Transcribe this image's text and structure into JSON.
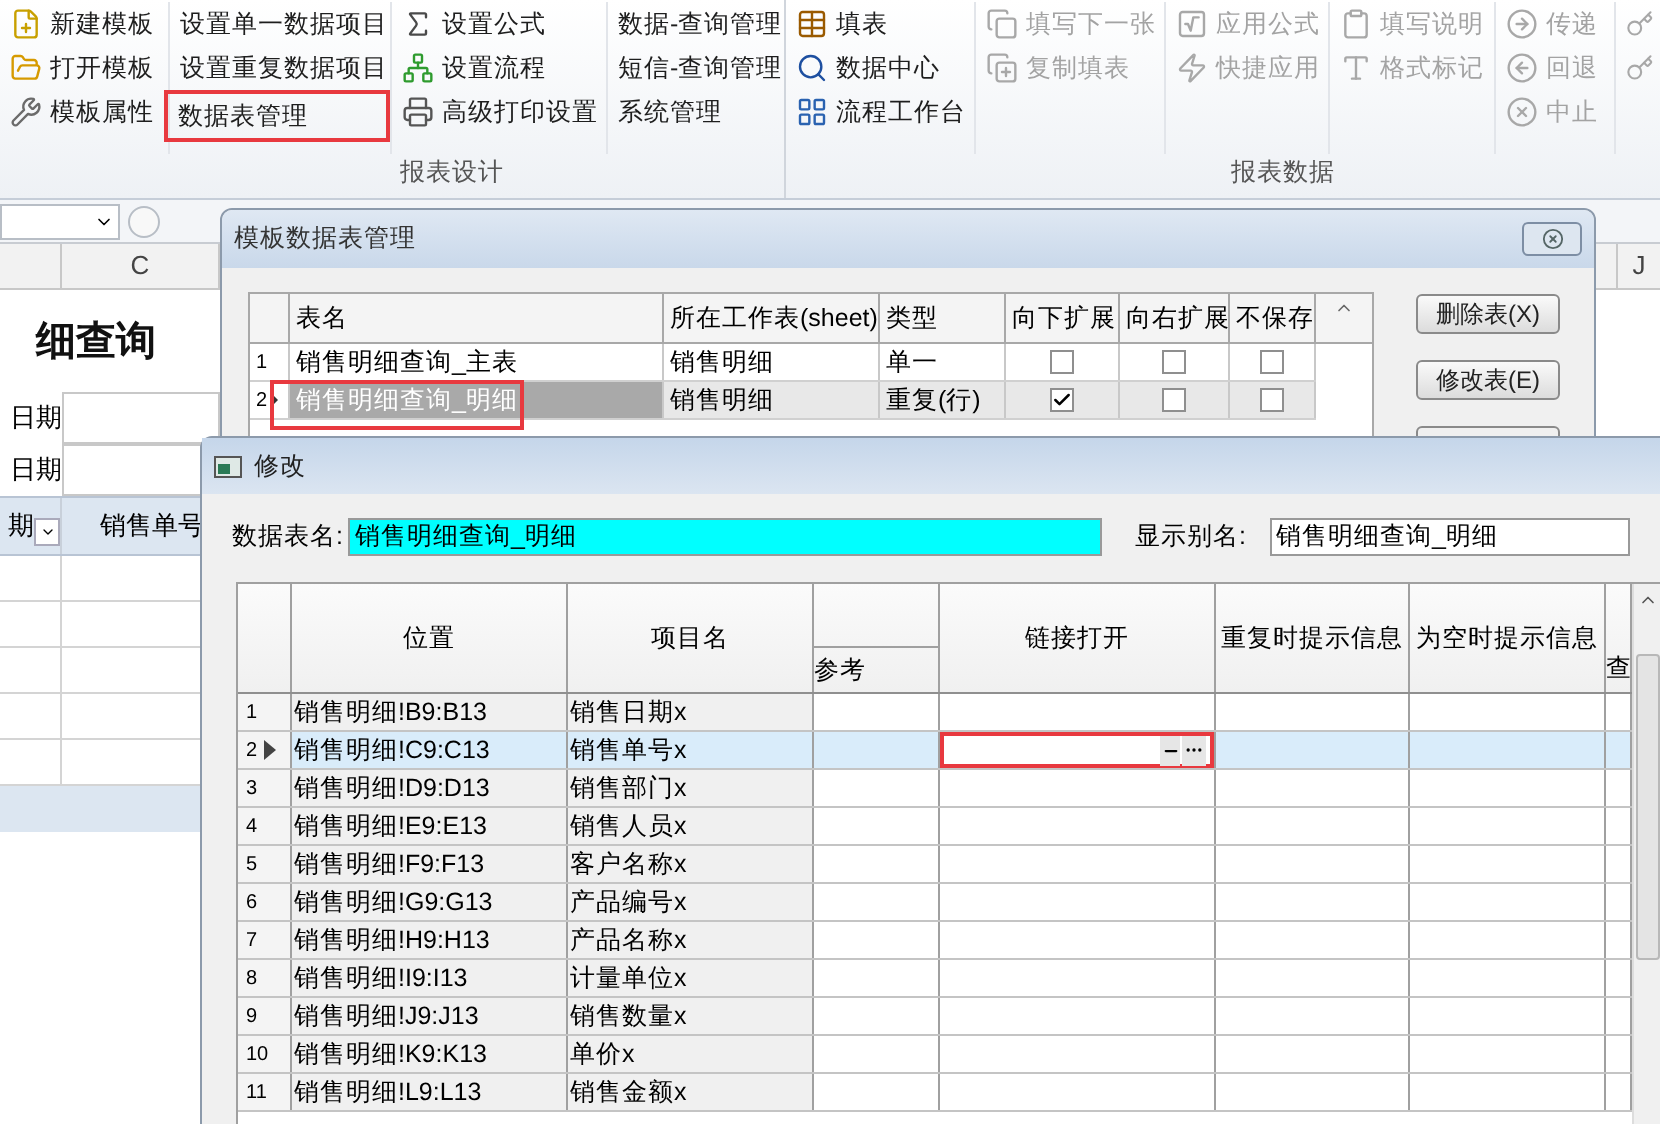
{
  "ribbon": {
    "groups": [
      {
        "label": "报表设计",
        "columns": [
          [
            {
              "label": "新建模板",
              "disabled": false,
              "highlighted": false
            },
            {
              "label": "打开模板",
              "disabled": false,
              "highlighted": false
            },
            {
              "label": "模板属性",
              "disabled": false,
              "highlighted": false
            }
          ],
          [
            {
              "label": "设置单一数据项目",
              "disabled": false,
              "highlighted": false
            },
            {
              "label": "设置重复数据项目",
              "disabled": false,
              "highlighted": false
            },
            {
              "label": "数据表管理",
              "disabled": false,
              "highlighted": true
            }
          ],
          [
            {
              "label": "设置公式",
              "disabled": false,
              "highlighted": false
            },
            {
              "label": "设置流程",
              "disabled": false,
              "highlighted": false
            },
            {
              "label": "高级打印设置",
              "disabled": false,
              "highlighted": false
            }
          ],
          [
            {
              "label": "数据-查询管理",
              "disabled": false,
              "highlighted": false
            },
            {
              "label": "短信-查询管理",
              "disabled": false,
              "highlighted": false
            },
            {
              "label": "系统管理",
              "disabled": false,
              "highlighted": false
            }
          ]
        ]
      },
      {
        "label": "报表数据",
        "columns": [
          [
            {
              "label": "填表",
              "disabled": false,
              "highlighted": false
            },
            {
              "label": "数据中心",
              "disabled": false,
              "highlighted": false
            },
            {
              "label": "流程工作台",
              "disabled": false,
              "highlighted": false
            }
          ],
          [
            {
              "label": "填写下一张",
              "disabled": true,
              "highlighted": false
            },
            {
              "label": "复制填表",
              "disabled": true,
              "highlighted": false
            }
          ],
          [
            {
              "label": "应用公式",
              "disabled": true,
              "highlighted": false
            },
            {
              "label": "快捷应用",
              "disabled": true,
              "highlighted": false
            }
          ],
          [
            {
              "label": "填写说明",
              "disabled": true,
              "highlighted": false
            },
            {
              "label": "格式标记",
              "disabled": true,
              "highlighted": false
            }
          ],
          [
            {
              "label": "传递",
              "disabled": true,
              "highlighted": false
            },
            {
              "label": "回退",
              "disabled": true,
              "highlighted": false
            },
            {
              "label": "中止",
              "disabled": true,
              "highlighted": false
            }
          ],
          [
            {
              "disabled": true,
              "highlighted": false
            },
            {
              "disabled": true,
              "highlighted": false
            }
          ]
        ]
      }
    ]
  },
  "sheet": {
    "column_headers": [
      "C",
      "J"
    ],
    "title": "细查询",
    "labels": [
      "日期",
      "日期"
    ],
    "header_cells": [
      "期",
      "销售单号"
    ]
  },
  "table_dialog": {
    "title": "模板数据表管理",
    "columns": [
      "表名",
      "所在工作表(sheet)",
      "类型",
      "向下扩展",
      "向右扩展",
      "不保存"
    ],
    "rows": [
      {
        "num": "1",
        "name": "销售明细查询_主表",
        "sheet": "销售明细",
        "type": "单一",
        "expand_down": false,
        "expand_right": false,
        "no_save": false,
        "selected": false,
        "highlighted": false
      },
      {
        "num": "2",
        "name": "销售明细查询_明细",
        "sheet": "销售明细",
        "type": "重复(行)",
        "expand_down": true,
        "expand_right": false,
        "no_save": false,
        "selected": true,
        "highlighted": true
      }
    ],
    "buttons": [
      "删除表(X)",
      "修改表(E)"
    ]
  },
  "edit_dialog": {
    "title": "修改",
    "table_name_label": "数据表名:",
    "table_name": "销售明细查询_明细",
    "alias_label": "显示别名:",
    "alias": "销售明细查询_明细",
    "columns": [
      {
        "label": "位置"
      },
      {
        "label": "项目名"
      },
      {
        "sublabel": "参考"
      },
      {
        "label": "链接打开"
      },
      {
        "label": "重复时提示信息"
      },
      {
        "label": "为空时提示信息"
      },
      {
        "label": "查"
      }
    ],
    "rows": [
      {
        "num": "1",
        "position": "销售明细!B9:B13",
        "item": "销售日期x",
        "selected": false,
        "link_highlighted": false
      },
      {
        "num": "2",
        "position": "销售明细!C9:C13",
        "item": "销售单号x",
        "selected": true,
        "link_highlighted": true
      },
      {
        "num": "3",
        "position": "销售明细!D9:D13",
        "item": "销售部门x",
        "selected": false,
        "link_highlighted": false
      },
      {
        "num": "4",
        "position": "销售明细!E9:E13",
        "item": "销售人员x",
        "selected": false,
        "link_highlighted": false
      },
      {
        "num": "5",
        "position": "销售明细!F9:F13",
        "item": "客户名称x",
        "selected": false,
        "link_highlighted": false
      },
      {
        "num": "6",
        "position": "销售明细!G9:G13",
        "item": "产品编号x",
        "selected": false,
        "link_highlighted": false
      },
      {
        "num": "7",
        "position": "销售明细!H9:H13",
        "item": "产品名称x",
        "selected": false,
        "link_highlighted": false
      },
      {
        "num": "8",
        "position": "销售明细!I9:I13",
        "item": "计量单位x",
        "selected": false,
        "link_highlighted": false
      },
      {
        "num": "9",
        "position": "销售明细!J9:J13",
        "item": "销售数量x",
        "selected": false,
        "link_highlighted": false
      },
      {
        "num": "10",
        "position": "销售明细!K9:K13",
        "item": "单价x",
        "selected": false,
        "link_highlighted": false
      },
      {
        "num": "11",
        "position": "销售明细!L9:L13",
        "item": "销售金额x",
        "selected": false,
        "link_highlighted": false
      }
    ]
  }
}
